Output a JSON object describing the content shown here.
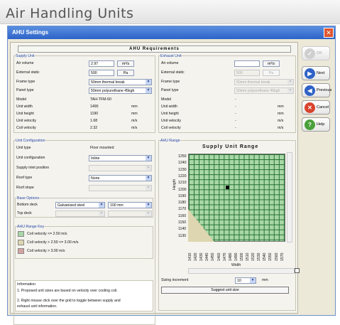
{
  "header": {
    "title": "Air Handling Units"
  },
  "window": {
    "title": "AHU Settings",
    "close": "✕"
  },
  "banner": "AHU Requirements",
  "supply": {
    "heading": "Supply Unit",
    "air_volume_label": "Air volume",
    "air_volume_value": "2.97",
    "air_volume_unit": "m³/s",
    "ext_static_label": "External static",
    "ext_static_value": "500",
    "ext_static_unit": "Pa",
    "frame_label": "Frame type",
    "frame_value": "50mm thermal break",
    "panel_label": "Panel type",
    "panel_value": "50mm polyurethane 45kgh",
    "model_label": "Model",
    "model_value": "TAH-TFM-60",
    "width_label": "Unit width",
    "width_value": "1490",
    "width_unit": "mm",
    "height_label": "Unit height",
    "height_value": "1190",
    "height_unit": "mm",
    "velocity_label": "Unit velocity",
    "velocity_value": "1.68",
    "velocity_unit": "m/s",
    "coil_label": "Coil velocity",
    "coil_value": "2.32",
    "coil_unit": "m/s"
  },
  "exhaust": {
    "heading": "Exhaust Unit",
    "air_volume_label": "Air volume",
    "air_volume_value": "",
    "air_volume_unit": "m³/s",
    "ext_static_label": "External static",
    "ext_static_value": "500",
    "ext_static_unit": "Pa",
    "frame_label": "Frame type",
    "frame_value": "50mm thermal break",
    "panel_label": "Panel type",
    "panel_value": "50mm polyurethane 45kgh",
    "model_label": "Model",
    "model_value": "-",
    "width_label": "Unit width",
    "width_value": "-",
    "width_unit": "mm",
    "height_label": "Unit height",
    "height_value": "-",
    "height_unit": "mm",
    "velocity_label": "Unit velocity",
    "velocity_value": "-",
    "velocity_unit": "m/s",
    "coil_label": "Coil velocity",
    "coil_value": "-",
    "coil_unit": "m/s"
  },
  "config": {
    "heading": "Unit Configuration",
    "type_label": "Unit type",
    "type_value": "Floor mounted",
    "conf_label": "Unit configuration",
    "conf_value": "Inline",
    "inlet_label": "Supply inlet position",
    "inlet_value": "",
    "roof_label": "Roof type",
    "roof_value": "None",
    "slope_label": "Roof slope",
    "slope_value": ""
  },
  "base": {
    "heading": "Base Options",
    "bottom_label": "Bottom deck",
    "bottom_value": "Galvanised steel",
    "bottom_size": "100 mm",
    "top_label": "Top deck",
    "top_value": "",
    "top_size": ""
  },
  "key": {
    "heading": "AHU Range Key",
    "items": [
      "Coil velocity <= 2.50 m/s",
      "Coil velocity > 2.50 <= 3.00 m/s",
      "Coil velocity > 3.00 m/s"
    ],
    "colors": [
      "#a9d7a7",
      "#ded6b0",
      "#d7a4a4"
    ]
  },
  "info": {
    "heading": "Information",
    "line1": "1.  Proposed unit sizes are based on velocity over cooling coil.",
    "line2": "2.  Right mouse click over the grid to toggle between supply and",
    "line3": "exhaust unit information."
  },
  "range": {
    "heading": "AHU Range",
    "title": "Supply Unit Range",
    "ylabel": "Height",
    "xlabel": "Width",
    "y_ticks": [
      "1250",
      "1240",
      "1230",
      "1220",
      "1210",
      "1200",
      "1190",
      "1180",
      "1170",
      "1160",
      "1150",
      "1140",
      "1130"
    ],
    "x_ticks": [
      "1410",
      "1420",
      "1430",
      "1440",
      "1450",
      "1460",
      "1470",
      "1480",
      "1490",
      "1500",
      "1510",
      "1520",
      "1530",
      "1540",
      "1550",
      "1560",
      "1570"
    ],
    "sizing_label": "Sizing increment",
    "sizing_value": "10",
    "sizing_unit": "mm",
    "suggest": "Suggest unit size"
  },
  "buttons": {
    "ok": "OK",
    "next": "Next",
    "previous": "Previous",
    "cancel": "Cancel",
    "help": "Help"
  }
}
